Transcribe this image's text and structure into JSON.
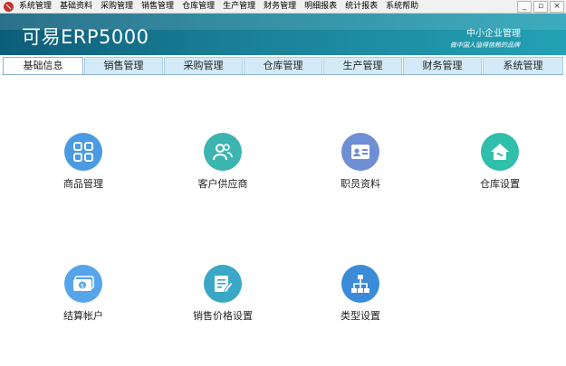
{
  "menubar": {
    "items": [
      "系统管理",
      "基础资料",
      "采购管理",
      "销售管理",
      "仓库管理",
      "生产管理",
      "财务管理",
      "明细报表",
      "统计报表",
      "系统帮助"
    ],
    "window_controls": [
      "_",
      "▫",
      "×"
    ]
  },
  "banner": {
    "title": "可易ERP5000",
    "subtitle": "中小企业管理",
    "tagline": "做中国人值得信赖的品牌"
  },
  "tabs": [
    {
      "label": "基础信息",
      "active": true
    },
    {
      "label": "销售管理",
      "active": false
    },
    {
      "label": "采购管理",
      "active": false
    },
    {
      "label": "仓库管理",
      "active": false
    },
    {
      "label": "生产管理",
      "active": false
    },
    {
      "label": "财务管理",
      "active": false
    },
    {
      "label": "系统管理",
      "active": false
    }
  ],
  "tiles": [
    {
      "label": "商品管理",
      "icon": "grid-icon",
      "color": "#4a9be2"
    },
    {
      "label": "客户供应商",
      "icon": "users-icon",
      "color": "#3cb4b0"
    },
    {
      "label": "职员资料",
      "icon": "id-card-icon",
      "color": "#6e8fd4"
    },
    {
      "label": "仓库设置",
      "icon": "warehouse-icon",
      "color": "#2fbfaa"
    },
    {
      "label": "结算帐户",
      "icon": "account-icon",
      "color": "#56a4ea"
    },
    {
      "label": "销售价格设置",
      "icon": "edit-icon",
      "color": "#3aa7c6"
    },
    {
      "label": "类型设置",
      "icon": "hierarchy-icon",
      "color": "#3a8bd8"
    }
  ]
}
